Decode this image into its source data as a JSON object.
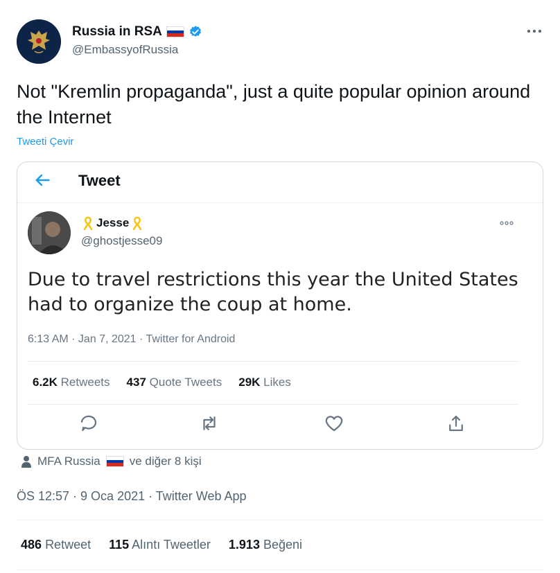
{
  "author": {
    "name": "Russia in RSA",
    "handle": "@EmbassyofRussia",
    "verified": true
  },
  "tweet": {
    "text": "Not \"Kremlin propaganda\", just a quite popular opinion around the Internet",
    "translate_label": "Tweeti Çevir"
  },
  "embedded": {
    "header_title": "Tweet",
    "author_name": "Jesse",
    "author_handle": "@ghostjesse09",
    "text": "Due to travel restrictions this year the United States had to organize the coup at home.",
    "meta": "6:13 AM · Jan 7, 2021 · Twitter for Android",
    "stats": [
      {
        "count": "6.2K",
        "label": "Retweets"
      },
      {
        "count": "437",
        "label": "Quote Tweets"
      },
      {
        "count": "29K",
        "label": "Likes"
      }
    ]
  },
  "retweeted_by": {
    "name": "MFA Russia",
    "suffix": "ve diğer 8 kişi"
  },
  "timestamp": "ÖS 12:57 · 9 Oca 2021 · Twitter Web App",
  "stats": [
    {
      "count": "486",
      "label": "Retweet"
    },
    {
      "count": "115",
      "label": "Alıntı Tweetler"
    },
    {
      "count": "1.913",
      "label": "Beğeni"
    }
  ],
  "colors": {
    "accent": "#1d9bf0",
    "secondary_text": "#536471",
    "ribbon": "#f5c518"
  },
  "icons": {
    "more": "more-horizontal-icon",
    "verified": "verified-badge-icon",
    "back": "arrow-left-icon",
    "reply": "reply-icon",
    "retweet": "retweet-icon",
    "like": "heart-icon",
    "share": "share-icon",
    "person": "person-icon"
  }
}
